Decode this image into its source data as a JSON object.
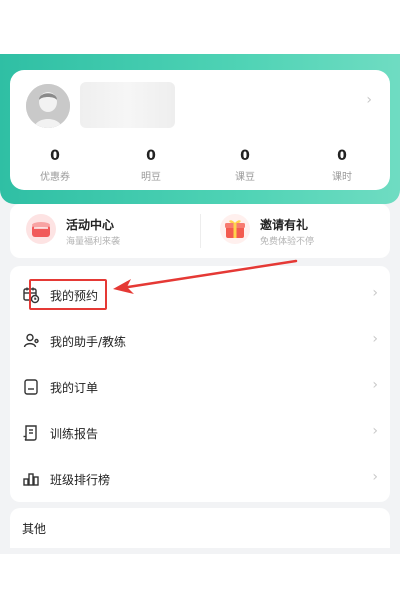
{
  "profile": {
    "stats": [
      {
        "value": "0",
        "label": "优惠券"
      },
      {
        "value": "0",
        "label": "明豆"
      },
      {
        "value": "0",
        "label": "课豆"
      },
      {
        "value": "0",
        "label": "课时"
      }
    ]
  },
  "promos": [
    {
      "title": "活动中心",
      "subtitle": "海量福利来袭"
    },
    {
      "title": "邀请有礼",
      "subtitle": "免费体验不停"
    }
  ],
  "menu": [
    {
      "label": "我的预约",
      "icon": "calendar-icon"
    },
    {
      "label": "我的助手/教练",
      "icon": "person-icon"
    },
    {
      "label": "我的订单",
      "icon": "order-icon"
    },
    {
      "label": "训练报告",
      "icon": "report-icon"
    },
    {
      "label": "班级排行榜",
      "icon": "ranking-icon"
    }
  ],
  "other": {
    "title": "其他"
  },
  "colors": {
    "header_green": "#3fcaa9",
    "annotation_red": "#e53935"
  }
}
